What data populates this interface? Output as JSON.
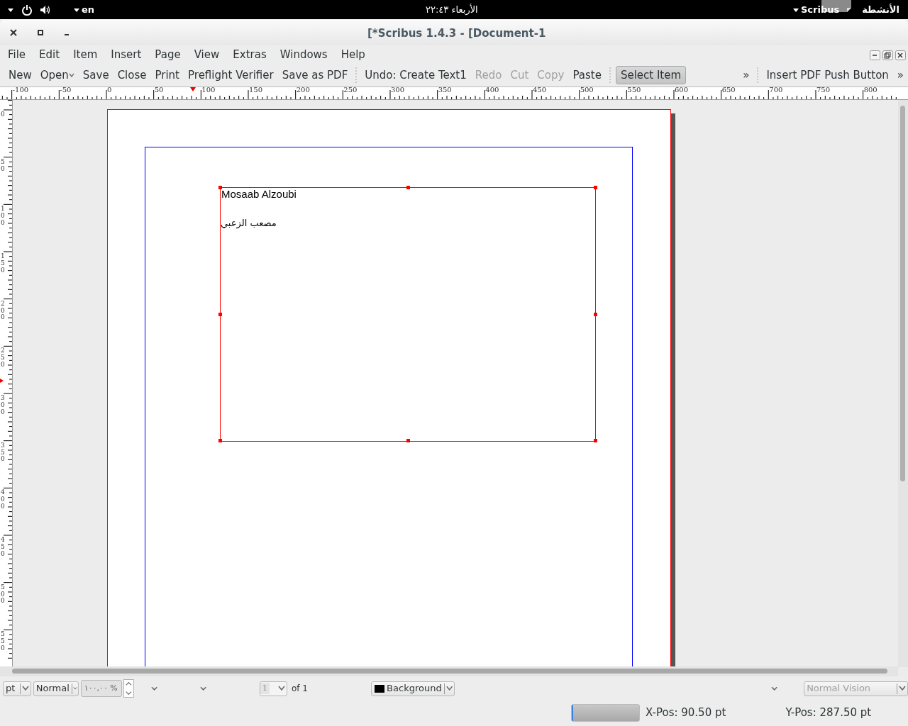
{
  "top_bar": {
    "keyboard": "en",
    "clock": "الأربعاء ٢٢:٤٣",
    "app": "Scribus",
    "activities": "الأنشطة"
  },
  "window": {
    "title": "[*Scribus 1.4.3 - [Document-1"
  },
  "menu": [
    "File",
    "Edit",
    "Item",
    "Insert",
    "Page",
    "View",
    "Extras",
    "Windows",
    "Help"
  ],
  "toolbar": [
    {
      "label": "New",
      "kind": "button",
      "disabled": false,
      "selected": false
    },
    {
      "label": "Open",
      "kind": "dropdown",
      "disabled": false,
      "selected": false
    },
    {
      "label": "Save",
      "kind": "button",
      "disabled": false,
      "selected": false
    },
    {
      "label": "Close",
      "kind": "button",
      "disabled": false,
      "selected": false
    },
    {
      "label": "Print",
      "kind": "button",
      "disabled": false,
      "selected": false
    },
    {
      "label": "Preflight Verifier",
      "kind": "button",
      "disabled": false,
      "selected": false
    },
    {
      "label": "Save as PDF",
      "kind": "button",
      "disabled": false,
      "selected": false
    },
    {
      "kind": "separator"
    },
    {
      "label": "Undo: Create Text1",
      "kind": "button",
      "disabled": false,
      "selected": false
    },
    {
      "label": "Redo",
      "kind": "button",
      "disabled": true,
      "selected": false
    },
    {
      "label": "Cut",
      "kind": "button",
      "disabled": true,
      "selected": false
    },
    {
      "label": "Copy",
      "kind": "button",
      "disabled": true,
      "selected": false
    },
    {
      "label": "Paste",
      "kind": "button",
      "disabled": false,
      "selected": false
    },
    {
      "kind": "separator"
    },
    {
      "label": "Select Item",
      "kind": "button",
      "disabled": false,
      "selected": true
    },
    {
      "kind": "spacer"
    },
    {
      "label": "»",
      "kind": "button",
      "disabled": false,
      "selected": false
    },
    {
      "kind": "separator"
    },
    {
      "label": "Insert PDF Push Button",
      "kind": "button",
      "disabled": false,
      "selected": false
    },
    {
      "label": "»",
      "kind": "button",
      "disabled": false,
      "selected": false
    }
  ],
  "horizontal_ruler": [
    "-100",
    "-50",
    "0",
    "50",
    "100",
    "150",
    "200",
    "250",
    "300",
    "350",
    "400",
    "450",
    "500",
    "550",
    "600",
    "650",
    "700",
    "750",
    "800"
  ],
  "vertical_ruler": [
    "0",
    "50",
    "100",
    "150",
    "200",
    "250",
    "300",
    "350",
    "400",
    "450",
    "500",
    "550"
  ],
  "text_frame": {
    "lines": [
      "Mosaab Alzoubi",
      "مصعب الزعبي"
    ]
  },
  "bottom_bar": {
    "unit": "pt",
    "quality": "Normal",
    "zoom": "١٠٠,٠٠ %",
    "page": "1",
    "page_count": "of 1",
    "layer": "Background",
    "vision": "Normal Vision"
  },
  "status_bar": {
    "progress": {
      "level": 0.02
    },
    "x_pos": "X-Pos: 90.50 pt",
    "y_pos": "Y-Pos: 287.50 pt"
  }
}
